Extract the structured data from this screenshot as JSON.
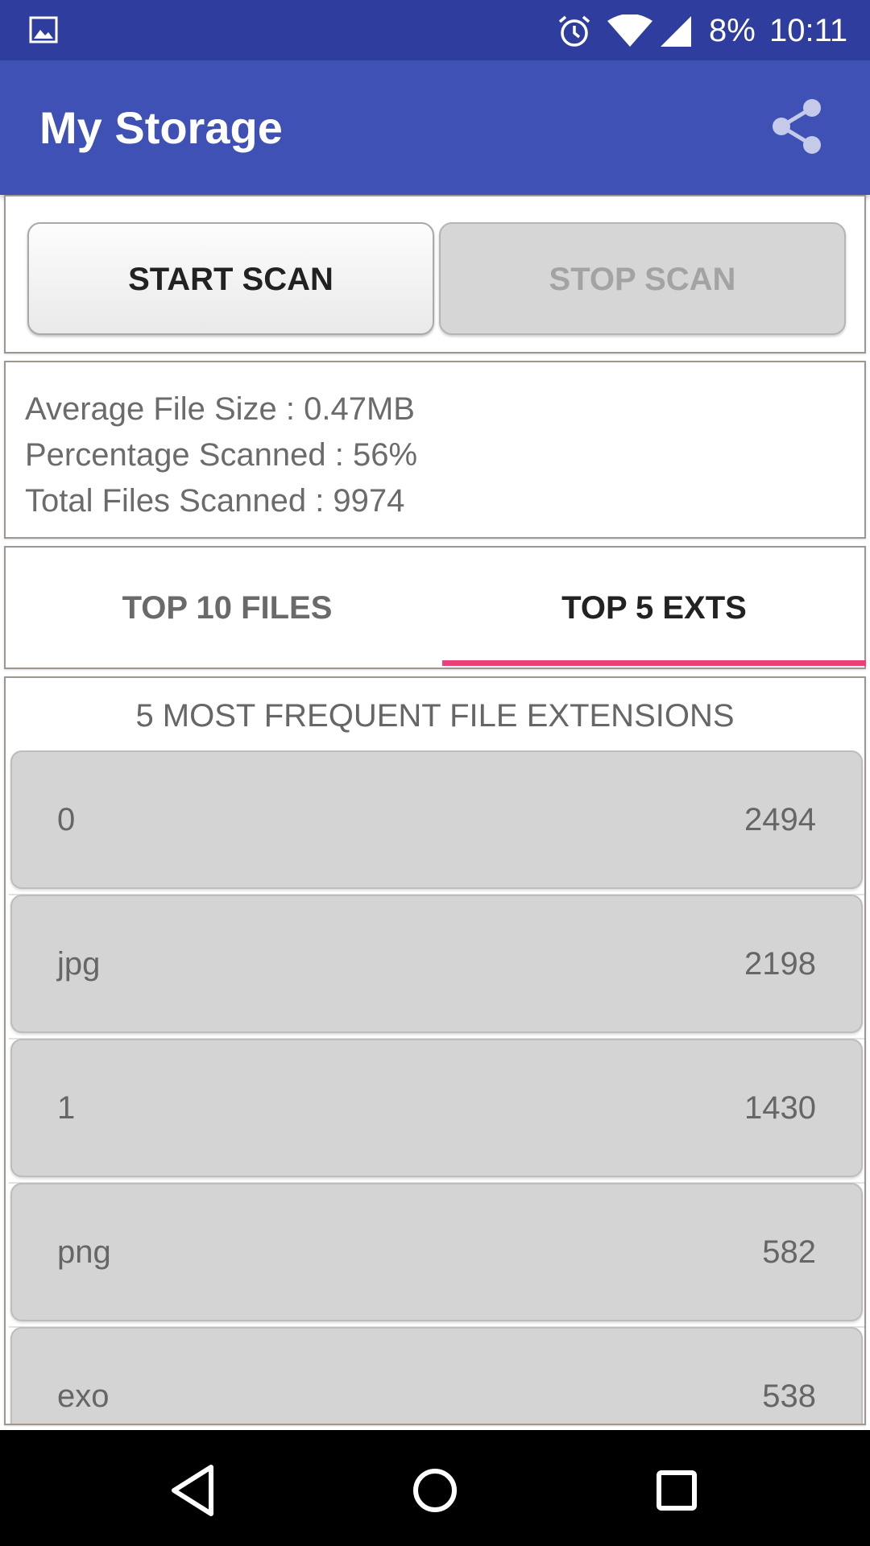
{
  "status_bar": {
    "battery": "8%",
    "time": "10:11",
    "icons": [
      "gallery-icon",
      "alarm-icon",
      "wifi-icon",
      "signal-icon"
    ]
  },
  "app_bar": {
    "title": "My Storage",
    "share_icon": "share-icon"
  },
  "scan_controls": {
    "start_label": "START SCAN",
    "stop_label": "STOP SCAN",
    "stop_enabled": false
  },
  "stats": {
    "average_file_size": "Average File Size : 0.47MB",
    "percentage_scanned": "Percentage Scanned : 56%",
    "total_files_scanned": "Total Files Scanned : 9974"
  },
  "tabs": [
    {
      "label": "TOP 10 FILES",
      "selected": false
    },
    {
      "label": "TOP 5 EXTS",
      "selected": true
    }
  ],
  "extensions": {
    "title": "5 MOST FREQUENT FILE EXTENSIONS",
    "rows": [
      {
        "name": "0",
        "count": "2494"
      },
      {
        "name": "jpg",
        "count": "2198"
      },
      {
        "name": "1",
        "count": "1430"
      },
      {
        "name": "png",
        "count": "582"
      },
      {
        "name": "exo",
        "count": "538"
      }
    ]
  },
  "colors": {
    "status_bar": "#2F3E9E",
    "app_bar": "#3F51B5",
    "tab_indicator": "#EB3F7A",
    "list_row": "#D4D4D4"
  },
  "nav_bar": {
    "icons": [
      "back-icon",
      "home-icon",
      "recents-icon"
    ]
  }
}
